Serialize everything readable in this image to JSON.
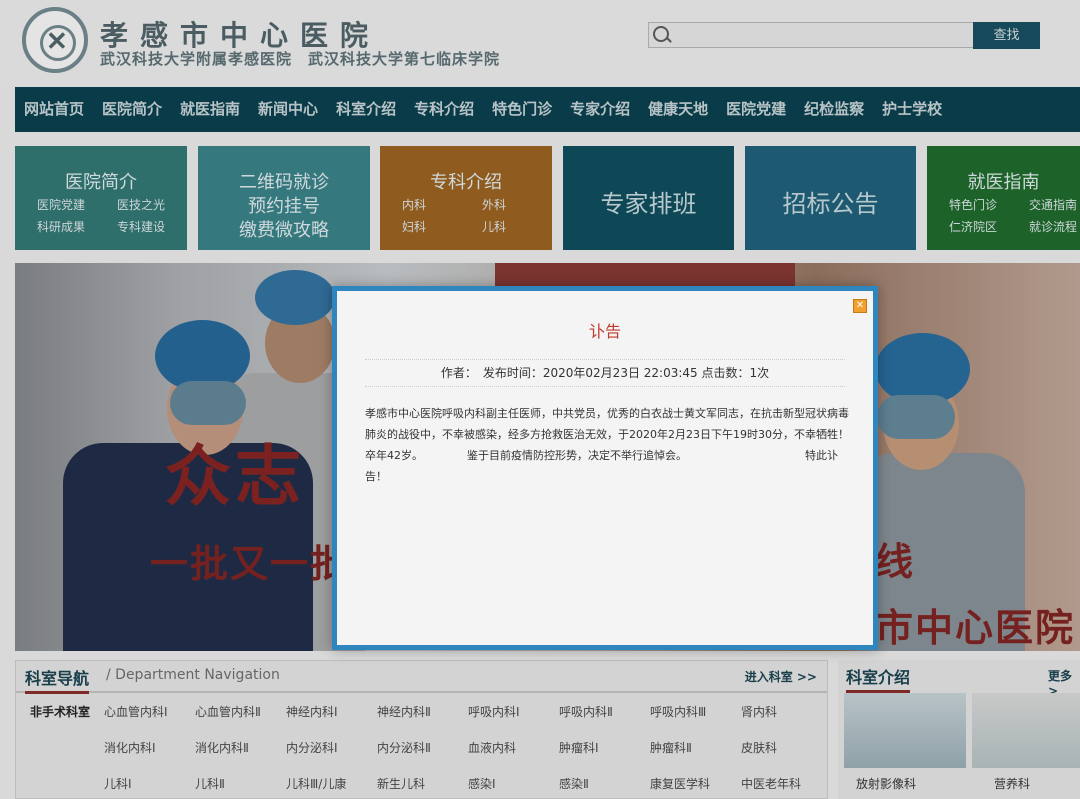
{
  "header": {
    "title": "孝感市中心医院",
    "subtitle": "武汉科技大学附属孝感医院　武汉科技大学第七临床学院",
    "search_placeholder": "",
    "search_button": "查找"
  },
  "nav": {
    "items": [
      "网站首页",
      "医院简介",
      "就医指南",
      "新闻中心",
      "科室介绍",
      "专科介绍",
      "特色门诊",
      "专家介绍",
      "健康天地",
      "医院党建",
      "纪检监察",
      "护士学校"
    ]
  },
  "tiles": [
    {
      "title": "医院简介",
      "links": [
        "医院党建",
        "医技之光",
        "科研成果",
        "专科建设"
      ]
    },
    {
      "lines": [
        "二维码就诊",
        "预约挂号",
        "缴费微攻略"
      ]
    },
    {
      "title": "专科介绍",
      "links": [
        "内科",
        "外科",
        "妇科",
        "儿科"
      ]
    },
    {
      "big": "专家排班"
    },
    {
      "big": "招标公告"
    },
    {
      "title": "就医指南",
      "links": [
        "特色门诊",
        "交通指南",
        "仁济院区",
        "就诊流程"
      ]
    }
  ],
  "banner": {
    "text1": "众志",
    "text2": "一批又一批",
    "text3": "线",
    "text4": "市中心医院"
  },
  "departments": {
    "title": "科室导航",
    "subtitle": "/ Department Navigation",
    "enter": "进入科室 >>",
    "row_label": "非手术科室",
    "rows": [
      [
        "心血管内科Ⅰ",
        "心血管内科Ⅱ",
        "神经内科Ⅰ",
        "神经内科Ⅱ",
        "呼吸内科Ⅰ",
        "呼吸内科Ⅱ",
        "呼吸内科Ⅲ",
        "肾内科"
      ],
      [
        "消化内科Ⅰ",
        "消化内科Ⅱ",
        "内分泌科Ⅰ",
        "内分泌科Ⅱ",
        "血液内科",
        "肿瘤科Ⅰ",
        "肿瘤科Ⅱ",
        "皮肤科"
      ],
      [
        "儿科Ⅰ",
        "儿科Ⅱ",
        "儿科Ⅲ/儿康",
        "新生儿科",
        "感染Ⅰ",
        "感染Ⅱ",
        "康复医学科",
        "中医老年科"
      ]
    ]
  },
  "dept_intro": {
    "title": "科室介绍",
    "more": "更多>",
    "captions": [
      "放射影像科",
      "营养科"
    ]
  },
  "modal": {
    "title": "讣告",
    "meta": "作者：　发布时间：2020年02月23日 22:03:45  点击数：1次",
    "body1": "孝感市中心医院呼吸内科副主任医师，中共党员，优秀的白衣战士黄文军同志，在抗击新型冠状病毒肺炎的战役中，不幸被感染，经多方抢救医治无效，于2020年2月23日下午19时30分，不幸牺牲！卒年42岁。",
    "body2": "鉴于目前疫情防控形势，决定不举行追悼会。",
    "body3": "特此讣告！"
  }
}
